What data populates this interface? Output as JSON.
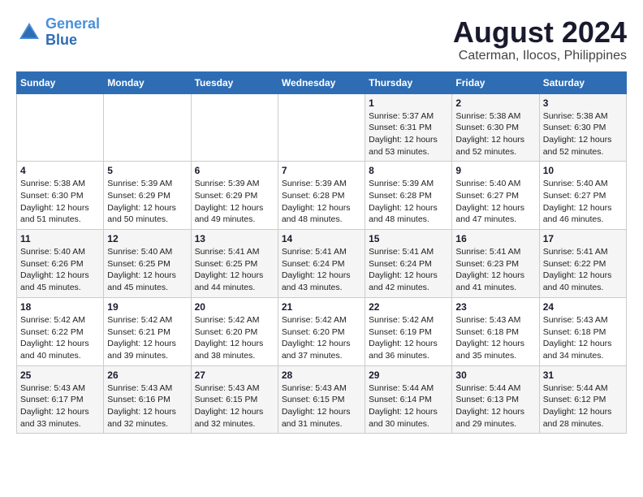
{
  "logo": {
    "line1": "General",
    "line2": "Blue"
  },
  "title": "August 2024",
  "subtitle": "Caterman, Ilocos, Philippines",
  "weekdays": [
    "Sunday",
    "Monday",
    "Tuesday",
    "Wednesday",
    "Thursday",
    "Friday",
    "Saturday"
  ],
  "weeks": [
    [
      {
        "day": "",
        "info": ""
      },
      {
        "day": "",
        "info": ""
      },
      {
        "day": "",
        "info": ""
      },
      {
        "day": "",
        "info": ""
      },
      {
        "day": "1",
        "info": "Sunrise: 5:37 AM\nSunset: 6:31 PM\nDaylight: 12 hours\nand 53 minutes."
      },
      {
        "day": "2",
        "info": "Sunrise: 5:38 AM\nSunset: 6:30 PM\nDaylight: 12 hours\nand 52 minutes."
      },
      {
        "day": "3",
        "info": "Sunrise: 5:38 AM\nSunset: 6:30 PM\nDaylight: 12 hours\nand 52 minutes."
      }
    ],
    [
      {
        "day": "4",
        "info": "Sunrise: 5:38 AM\nSunset: 6:30 PM\nDaylight: 12 hours\nand 51 minutes."
      },
      {
        "day": "5",
        "info": "Sunrise: 5:39 AM\nSunset: 6:29 PM\nDaylight: 12 hours\nand 50 minutes."
      },
      {
        "day": "6",
        "info": "Sunrise: 5:39 AM\nSunset: 6:29 PM\nDaylight: 12 hours\nand 49 minutes."
      },
      {
        "day": "7",
        "info": "Sunrise: 5:39 AM\nSunset: 6:28 PM\nDaylight: 12 hours\nand 48 minutes."
      },
      {
        "day": "8",
        "info": "Sunrise: 5:39 AM\nSunset: 6:28 PM\nDaylight: 12 hours\nand 48 minutes."
      },
      {
        "day": "9",
        "info": "Sunrise: 5:40 AM\nSunset: 6:27 PM\nDaylight: 12 hours\nand 47 minutes."
      },
      {
        "day": "10",
        "info": "Sunrise: 5:40 AM\nSunset: 6:27 PM\nDaylight: 12 hours\nand 46 minutes."
      }
    ],
    [
      {
        "day": "11",
        "info": "Sunrise: 5:40 AM\nSunset: 6:26 PM\nDaylight: 12 hours\nand 45 minutes."
      },
      {
        "day": "12",
        "info": "Sunrise: 5:40 AM\nSunset: 6:25 PM\nDaylight: 12 hours\nand 45 minutes."
      },
      {
        "day": "13",
        "info": "Sunrise: 5:41 AM\nSunset: 6:25 PM\nDaylight: 12 hours\nand 44 minutes."
      },
      {
        "day": "14",
        "info": "Sunrise: 5:41 AM\nSunset: 6:24 PM\nDaylight: 12 hours\nand 43 minutes."
      },
      {
        "day": "15",
        "info": "Sunrise: 5:41 AM\nSunset: 6:24 PM\nDaylight: 12 hours\nand 42 minutes."
      },
      {
        "day": "16",
        "info": "Sunrise: 5:41 AM\nSunset: 6:23 PM\nDaylight: 12 hours\nand 41 minutes."
      },
      {
        "day": "17",
        "info": "Sunrise: 5:41 AM\nSunset: 6:22 PM\nDaylight: 12 hours\nand 40 minutes."
      }
    ],
    [
      {
        "day": "18",
        "info": "Sunrise: 5:42 AM\nSunset: 6:22 PM\nDaylight: 12 hours\nand 40 minutes."
      },
      {
        "day": "19",
        "info": "Sunrise: 5:42 AM\nSunset: 6:21 PM\nDaylight: 12 hours\nand 39 minutes."
      },
      {
        "day": "20",
        "info": "Sunrise: 5:42 AM\nSunset: 6:20 PM\nDaylight: 12 hours\nand 38 minutes."
      },
      {
        "day": "21",
        "info": "Sunrise: 5:42 AM\nSunset: 6:20 PM\nDaylight: 12 hours\nand 37 minutes."
      },
      {
        "day": "22",
        "info": "Sunrise: 5:42 AM\nSunset: 6:19 PM\nDaylight: 12 hours\nand 36 minutes."
      },
      {
        "day": "23",
        "info": "Sunrise: 5:43 AM\nSunset: 6:18 PM\nDaylight: 12 hours\nand 35 minutes."
      },
      {
        "day": "24",
        "info": "Sunrise: 5:43 AM\nSunset: 6:18 PM\nDaylight: 12 hours\nand 34 minutes."
      }
    ],
    [
      {
        "day": "25",
        "info": "Sunrise: 5:43 AM\nSunset: 6:17 PM\nDaylight: 12 hours\nand 33 minutes."
      },
      {
        "day": "26",
        "info": "Sunrise: 5:43 AM\nSunset: 6:16 PM\nDaylight: 12 hours\nand 32 minutes."
      },
      {
        "day": "27",
        "info": "Sunrise: 5:43 AM\nSunset: 6:15 PM\nDaylight: 12 hours\nand 32 minutes."
      },
      {
        "day": "28",
        "info": "Sunrise: 5:43 AM\nSunset: 6:15 PM\nDaylight: 12 hours\nand 31 minutes."
      },
      {
        "day": "29",
        "info": "Sunrise: 5:44 AM\nSunset: 6:14 PM\nDaylight: 12 hours\nand 30 minutes."
      },
      {
        "day": "30",
        "info": "Sunrise: 5:44 AM\nSunset: 6:13 PM\nDaylight: 12 hours\nand 29 minutes."
      },
      {
        "day": "31",
        "info": "Sunrise: 5:44 AM\nSunset: 6:12 PM\nDaylight: 12 hours\nand 28 minutes."
      }
    ]
  ]
}
